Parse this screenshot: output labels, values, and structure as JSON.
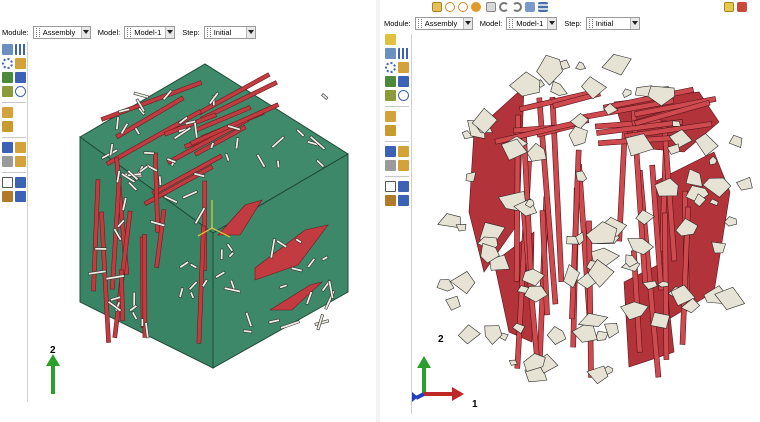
{
  "left": {
    "context_bar": {
      "module_label": "Module:",
      "module_value": "Assembly",
      "model_label": "Model:",
      "model_value": "Model-1",
      "step_label": "Step:",
      "step_value": "Initial"
    },
    "triad": {
      "axis_label": "2"
    },
    "model_colors": {
      "matrix": "#3f8a6b",
      "long_fibers": "#c23b40",
      "short_fibers": "#efece3"
    }
  },
  "right": {
    "context_bar": {
      "module_label": "Module:",
      "module_value": "Assembly",
      "model_label": "Model:",
      "model_value": "Model-1",
      "step_label": "Step:",
      "step_value": "Initial"
    },
    "triad": {
      "axis_y_label": "2",
      "axis_x_label": "1"
    },
    "model_colors": {
      "long_fibers": "#b3333a",
      "flakes": "#e6e2d4"
    }
  },
  "icons": [
    "create-instance-icon",
    "linear-pattern-icon",
    "radial-pattern-icon",
    "translate-icon",
    "rotate-icon",
    "constraint-icon",
    "merge-icon",
    "query-icon",
    "datum-csys-icon",
    "view-triad-icon",
    "select-icon",
    "undo-icon",
    "redo-icon",
    "render-icon"
  ]
}
